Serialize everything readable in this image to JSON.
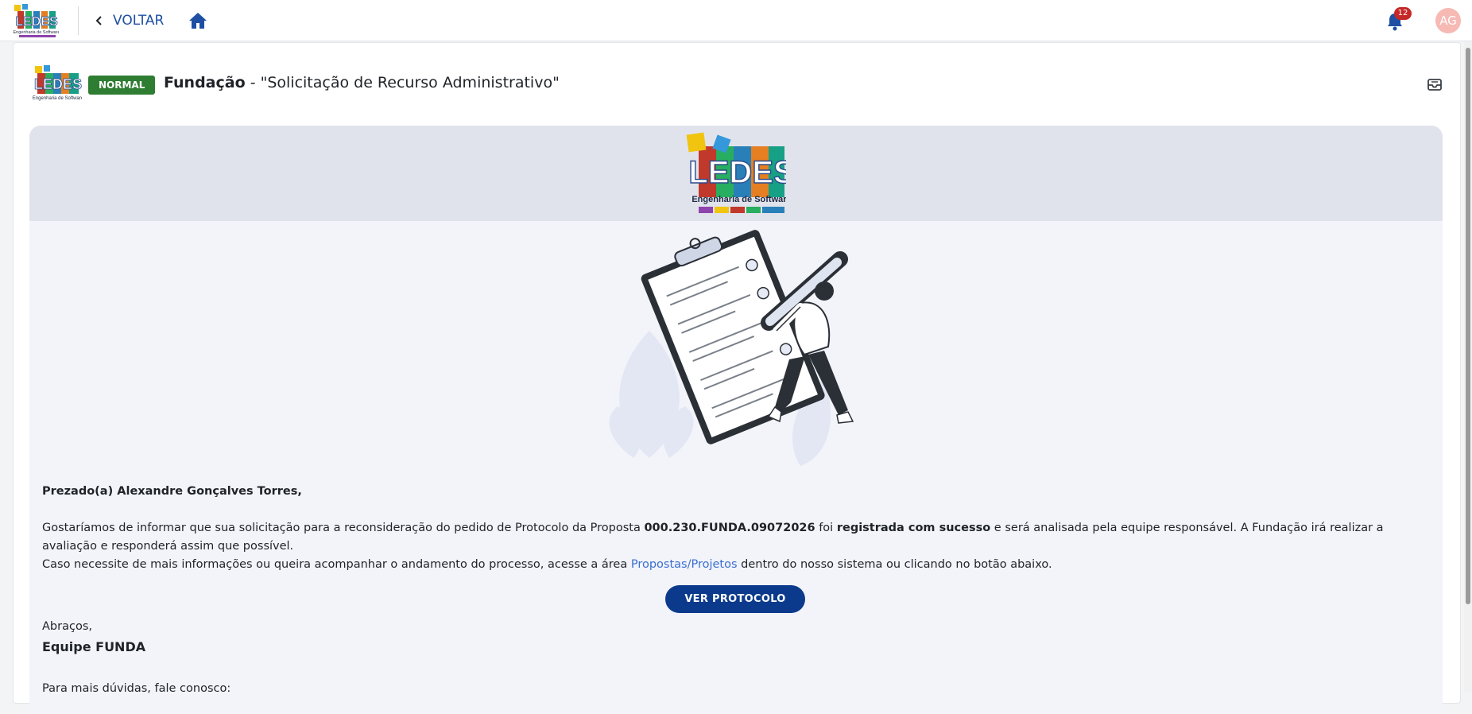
{
  "topbar": {
    "back_label": "VOLTAR",
    "notification_count": "12",
    "avatar_initials": "AG",
    "logo_icon": "ledes-logo",
    "home_icon": "home-icon",
    "bell_icon": "bell-icon"
  },
  "header": {
    "priority": "NORMAL",
    "entity": "Fundação",
    "separator": " - ",
    "subject": "\"Solicitação de Recurso Administrativo\"",
    "inbox_icon": "inbox-icon"
  },
  "email": {
    "logo_main": "LEDES",
    "logo_sub": "Engenharia de Software",
    "greeting": "Prezado(a) Alexandre Gonçalves Torres,",
    "p1_a": "Gostaríamos de informar que sua solicitação para a reconsideração do pedido de Protocolo da Proposta ",
    "p1_protocol": "000.230.FUNDA.09072026",
    "p1_b": " foi ",
    "p1_status": "registrada com sucesso",
    "p1_c": " e será analisada pela equipe responsável. A Fundação irá realizar a avaliação e responderá assim que possível.",
    "p2_a": "Caso necessite de mais informações ou queira acompanhar o andamento do processo, acesse a área ",
    "p2_link": "Propostas/Projetos",
    "p2_b": " dentro do nosso sistema ou clicando no botão abaixo.",
    "button_label": "VER PROTOCOLO",
    "signoff": "Abraços,",
    "team": "Equipe FUNDA",
    "more_info": "Para mais dúvidas, fale conosco:"
  },
  "colors": {
    "accent": "#0b3a8c",
    "badge_green": "#2e7d32",
    "notification_red": "#c62828",
    "link": "#3b6fd0"
  }
}
